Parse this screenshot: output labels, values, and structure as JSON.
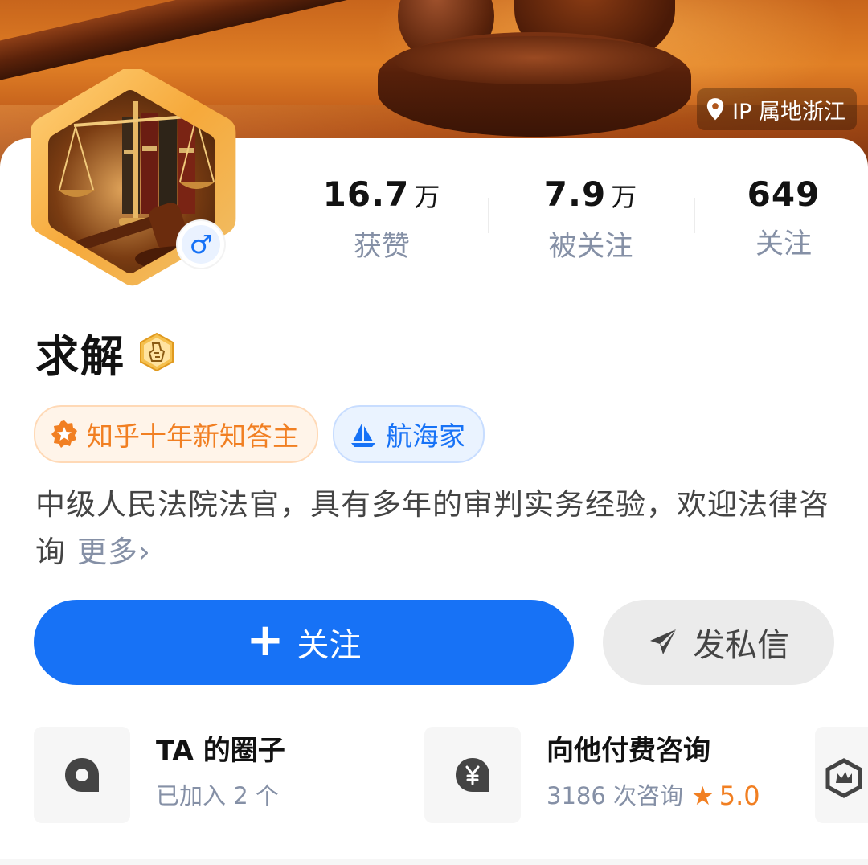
{
  "banner": {
    "ip_location": "IP 属地浙江"
  },
  "profile": {
    "name": "求解",
    "gender_symbol": "♂"
  },
  "stats": [
    {
      "value": "16.7",
      "unit": "万",
      "label": "获赞"
    },
    {
      "value": "7.9",
      "unit": "万",
      "label": "被关注"
    },
    {
      "value": "649",
      "unit": "",
      "label": "关注"
    }
  ],
  "badges": [
    {
      "label": "知乎十年新知答主"
    },
    {
      "label": "航海家"
    }
  ],
  "bio": {
    "text": "中级人民法院法官，具有多年的审判实务经验，欢迎法律咨询",
    "more": "更多›"
  },
  "actions": {
    "follow_plus": "+",
    "follow_label": "关注",
    "message_label": "发私信"
  },
  "features": [
    {
      "title": "TA 的圈子",
      "subtitle": "已加入 2 个"
    },
    {
      "title": "向他付费咨询",
      "subtitle": "3186 次咨询",
      "rating_star": "★",
      "rating": "5.0"
    }
  ],
  "colors": {
    "accent_blue": "#1772f6",
    "accent_orange": "#f17f22",
    "muted_text": "#8590a6"
  }
}
